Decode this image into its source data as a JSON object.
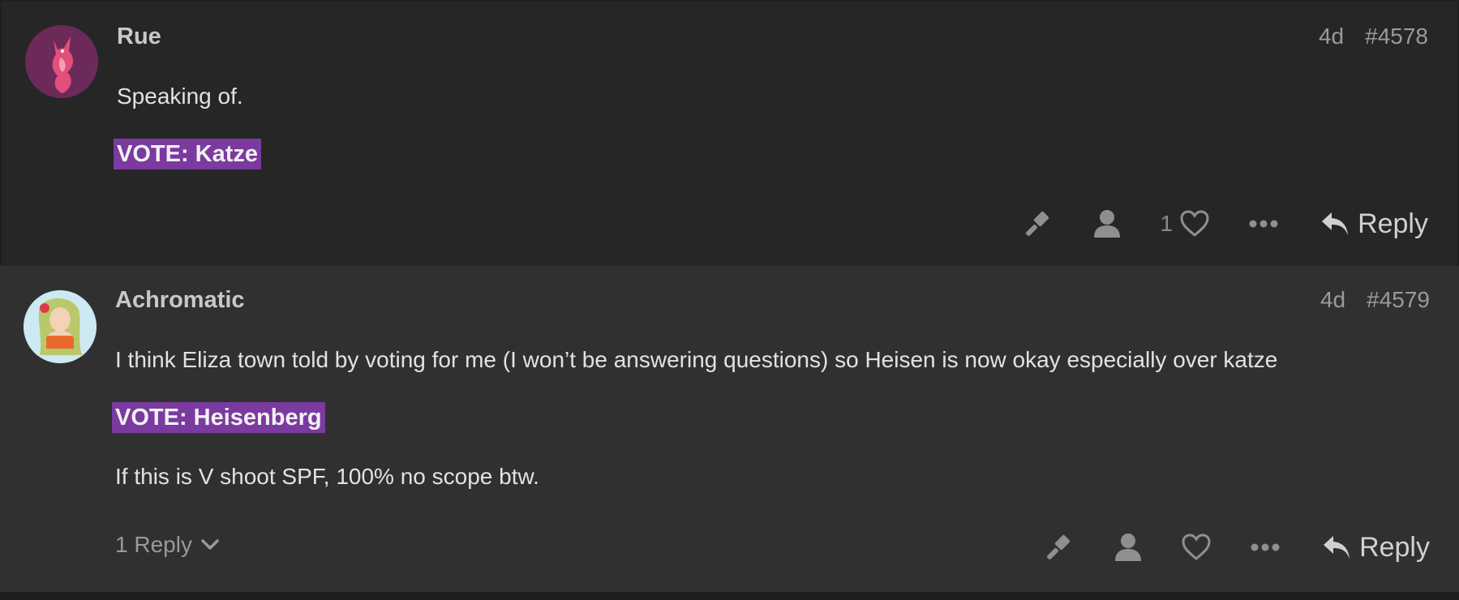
{
  "posts": [
    {
      "username": "Rue",
      "age": "4d",
      "number": "#4578",
      "paragraphs": [
        "Speaking of."
      ],
      "vote": "VOTE: Katze",
      "like_count": "1",
      "reply_label": "Reply",
      "avatar_icon": "fox-character-avatar"
    },
    {
      "username": "Achromatic",
      "age": "4d",
      "number": "#4579",
      "paragraphs": [
        "I think Eliza town told by voting for me (I won’t be answering questions) so Heisen is now okay especially over katze",
        "If this is V shoot SPF, 100% no scope btw."
      ],
      "vote": "VOTE: Heisenberg",
      "replies_toggle": "1 Reply",
      "reply_label": "Reply",
      "avatar_icon": "anime-girl-avatar"
    }
  ],
  "colors": {
    "vote_highlight": "#7b3aa0",
    "post_bg_1": "#262626",
    "post_bg_2": "#303030"
  },
  "icons": [
    "gavel-icon",
    "user-icon",
    "heart-icon",
    "more-icon",
    "reply-arrow-icon",
    "chevron-down-icon"
  ]
}
